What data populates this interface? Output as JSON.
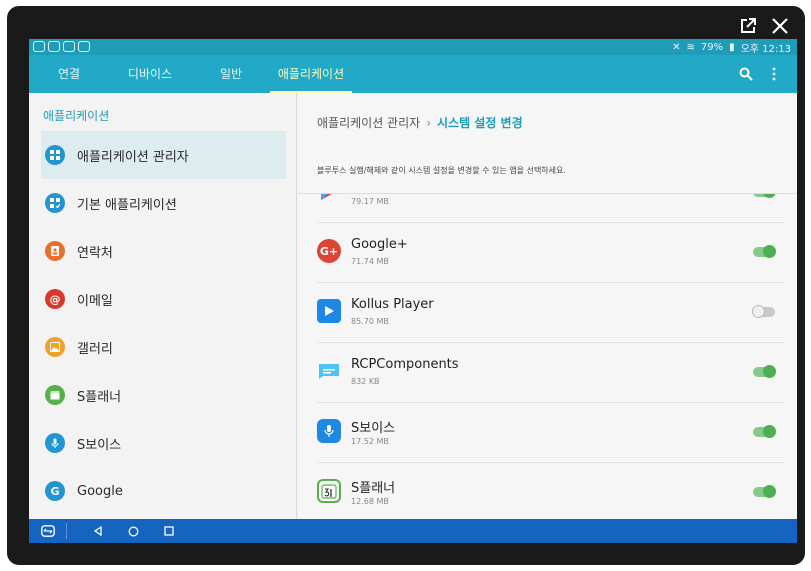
{
  "window": {
    "external_icon": "open-external-icon",
    "close_icon": "close-icon"
  },
  "statusbar": {
    "battery": "79%",
    "time": "오후 12:13"
  },
  "tabs": [
    {
      "label": "연결",
      "active": false
    },
    {
      "label": "디바이스",
      "active": false
    },
    {
      "label": "일반",
      "active": false
    },
    {
      "label": "애플리케이션",
      "active": true
    }
  ],
  "appbar": {
    "search_icon": "search-icon",
    "more_icon": "more-vert-icon"
  },
  "sidebar": {
    "header": "애플리케이션",
    "items": [
      {
        "label": "애플리케이션 관리자",
        "icon": "grid-icon",
        "color": "#2196d3",
        "selected": true
      },
      {
        "label": "기본 애플리케이션",
        "icon": "default-apps-icon",
        "color": "#2196d3",
        "selected": false
      },
      {
        "label": "연락처",
        "icon": "contacts-icon",
        "color": "#e8702a",
        "selected": false
      },
      {
        "label": "이메일",
        "icon": "email-icon",
        "color": "#d9382e",
        "selected": false
      },
      {
        "label": "갤러리",
        "icon": "gallery-icon",
        "color": "#f0a12a",
        "selected": false
      },
      {
        "label": "S플래너",
        "icon": "calendar-icon",
        "color": "#57b04b",
        "selected": false
      },
      {
        "label": "S보이스",
        "icon": "mic-icon",
        "color": "#2196d3",
        "selected": false
      },
      {
        "label": "Google",
        "icon": "google-icon",
        "color": "#2196d3",
        "selected": false
      }
    ]
  },
  "main": {
    "breadcrumb_parent": "애플리케이션 관리자",
    "breadcrumb_sep": "›",
    "breadcrumb_current": "시스템 설정 변경",
    "description": "블루투스 실행/해제와 같이 시스템 설정을 변경할 수 있는 앱을 선택하세요.",
    "apps": [
      {
        "name": "",
        "size": "79.17 MB",
        "icon": "play-store-icon",
        "enabled": true
      },
      {
        "name": "Google+",
        "size": "71.74 MB",
        "icon": "google-plus-icon",
        "enabled": true
      },
      {
        "name": "Kollus Player",
        "size": "85.70 MB",
        "icon": "kollus-player-icon",
        "enabled": false
      },
      {
        "name": "RCPComponents",
        "size": "832 KB",
        "icon": "rcp-components-icon",
        "enabled": true
      },
      {
        "name": "S보이스",
        "size": "17.52 MB",
        "icon": "s-voice-icon",
        "enabled": true
      },
      {
        "name": "S플래너",
        "size": "12.68 MB",
        "icon": "s-planner-icon",
        "enabled": true
      }
    ]
  },
  "navbar": {
    "remote_icon": "remote-control-icon",
    "back_icon": "back-icon",
    "home_icon": "home-icon",
    "recents_icon": "recents-icon"
  }
}
